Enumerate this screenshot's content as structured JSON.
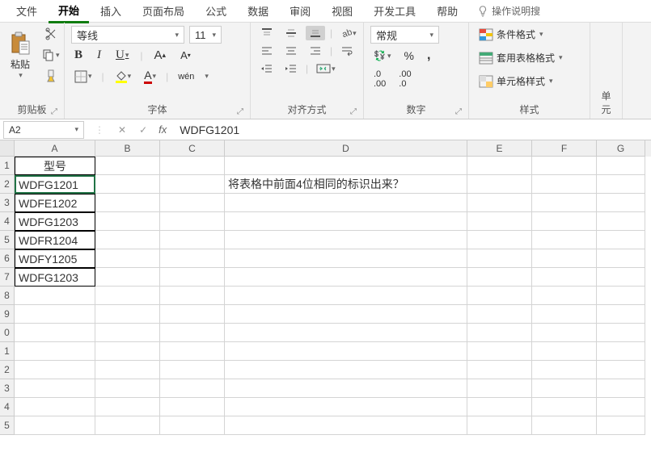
{
  "tabs": {
    "file": "文件",
    "home": "开始",
    "insert": "插入",
    "layout": "页面布局",
    "formula": "公式",
    "data": "数据",
    "review": "审阅",
    "view": "视图",
    "dev": "开发工具",
    "help": "帮助",
    "tell_me": "操作说明搜"
  },
  "ribbon": {
    "clipboard": {
      "paste": "粘贴",
      "label": "剪贴板"
    },
    "font": {
      "name": "等线",
      "size": "11",
      "label": "字体",
      "ruby": "wén"
    },
    "align": {
      "label": "对齐方式"
    },
    "number": {
      "format": "常规",
      "label": "数字"
    },
    "styles": {
      "cond": "条件格式",
      "table": "套用表格格式",
      "cell": "单元格样式",
      "label": "样式"
    },
    "edit": {
      "label": "单元"
    }
  },
  "formula_bar": {
    "name_box": "A2",
    "value": "WDFG1201"
  },
  "sheet": {
    "columns": [
      "A",
      "B",
      "C",
      "D",
      "E",
      "F",
      "G"
    ],
    "rows": [
      {
        "n": "1",
        "A": "型号",
        "D": ""
      },
      {
        "n": "2",
        "A": "WDFG1201",
        "D": "将表格中前面4位相同的标识出来？"
      },
      {
        "n": "3",
        "A": "WDFE1202"
      },
      {
        "n": "4",
        "A": "WDFG1203"
      },
      {
        "n": "5",
        "A": "WDFR1204"
      },
      {
        "n": "6",
        "A": "WDFY1205"
      },
      {
        "n": "7",
        "A": "WDFG1203"
      },
      {
        "n": "8"
      },
      {
        "n": "9"
      },
      {
        "n": "0"
      },
      {
        "n": "1"
      },
      {
        "n": "2"
      },
      {
        "n": "3"
      },
      {
        "n": "4"
      },
      {
        "n": "5"
      }
    ]
  }
}
